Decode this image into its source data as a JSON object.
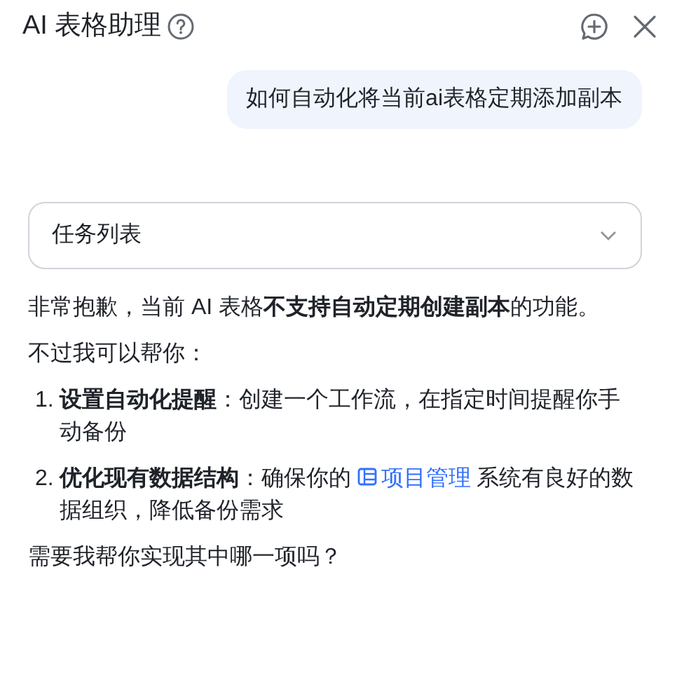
{
  "header": {
    "title": "AI 表格助理"
  },
  "user_message": "如何自动化将当前ai表格定期添加副本",
  "dropdown": {
    "value": "任务列表",
    "expanded": false
  },
  "reply": {
    "intro": "非常抱歉，当前 AI 表格**不支持自动定期创建副本**的功能。",
    "lead": "不过我可以帮你：",
    "items": [
      {
        "number": "1.",
        "text": "**设置自动化提醒**：创建一个工作流，在指定时间提醒你手动备份"
      },
      {
        "number": "2.",
        "text": "**优化现有数据结构**：确保你的 ",
        "link": "项目管理",
        "text_after": " 系统有良好的数据组织，降低备份需求"
      }
    ],
    "question": "需要我帮你实现其中哪一项吗？"
  }
}
